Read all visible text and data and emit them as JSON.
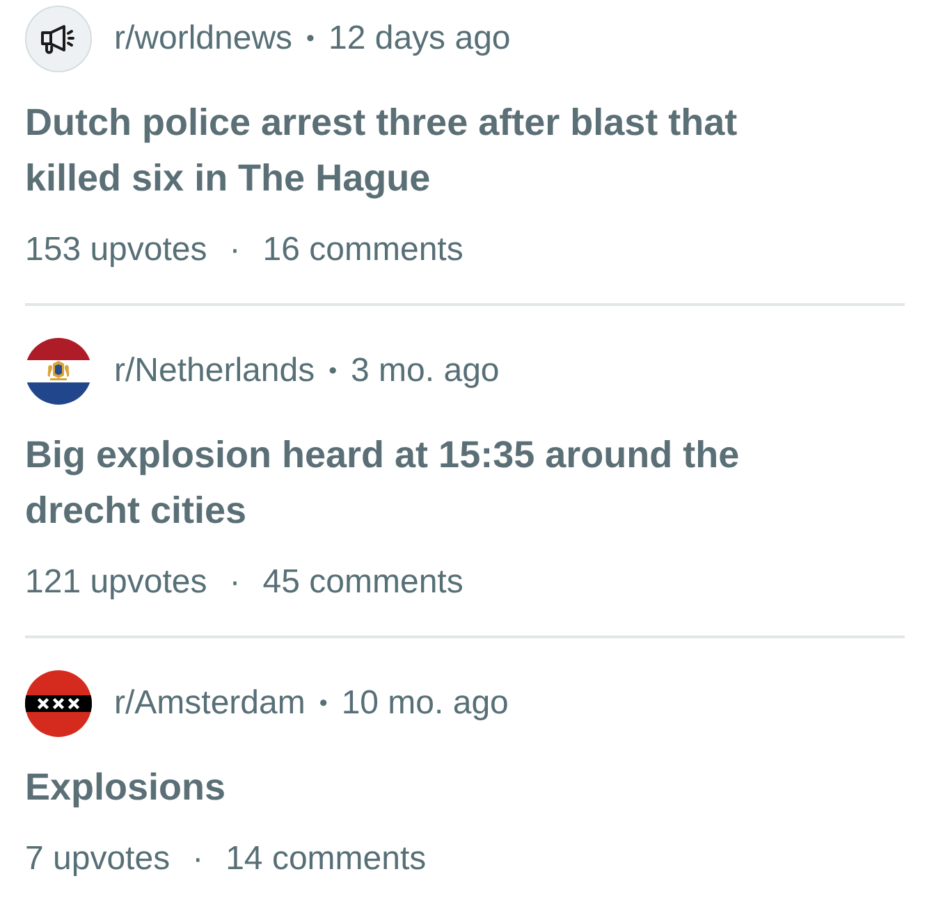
{
  "posts": [
    {
      "avatar": {
        "kind": "megaphone"
      },
      "community": "r/worldnews",
      "meta_separator": "•",
      "age": "12 days ago",
      "title": "Dutch police arrest three after blast that killed six in The Hague",
      "upvotes": "153 upvotes",
      "stats_separator": "·",
      "comments": "16 comments"
    },
    {
      "avatar": {
        "kind": "netherlands"
      },
      "community": "r/Netherlands",
      "meta_separator": "•",
      "age": "3 mo. ago",
      "title": "Big explosion heard at 15:35 around the drecht cities",
      "upvotes": "121 upvotes",
      "stats_separator": "·",
      "comments": "45 comments"
    },
    {
      "avatar": {
        "kind": "amsterdam"
      },
      "community": "r/Amsterdam",
      "meta_separator": "•",
      "age": "10 mo. ago",
      "title": "Explosions",
      "upvotes": "7 upvotes",
      "stats_separator": "·",
      "comments": "14 comments"
    }
  ]
}
